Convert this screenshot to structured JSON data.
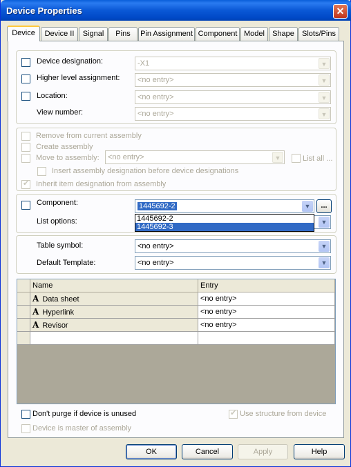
{
  "window": {
    "title": "Device Properties",
    "close": "✕"
  },
  "tabs": [
    {
      "label": "Device",
      "active": true
    },
    {
      "label": "Device II"
    },
    {
      "label": "Signal"
    },
    {
      "label": "Pins"
    },
    {
      "label": "Pin Assignment"
    },
    {
      "label": "Component"
    },
    {
      "label": "Model"
    },
    {
      "label": "Shape"
    },
    {
      "label": "Slots/Pins"
    }
  ],
  "designation": {
    "device_designation_label": "Device designation:",
    "device_designation_value": "-X1",
    "higher_level_label": "Higher level assignment:",
    "higher_level_value": "<no entry>",
    "location_label": "Location:",
    "location_value": "<no entry>",
    "view_number_label": "View number:",
    "view_number_value": "<no entry>"
  },
  "assembly": {
    "remove_label": "Remove from current assembly",
    "create_label": "Create assembly",
    "move_label": "Move to assembly:",
    "move_value": "<no entry>",
    "list_all_label": "List all ...",
    "insert_label": "Insert assembly designation before device designations",
    "inherit_label": "Inherit item designation from assembly"
  },
  "component": {
    "label": "Component:",
    "value": "1445692-2",
    "browse": "...",
    "list_options_label": "List options:",
    "dropdown_options": [
      "1445692-2",
      "1445692-3"
    ],
    "highlighted_option": "1445692-3"
  },
  "symbols": {
    "table_symbol_label": "Table symbol:",
    "table_symbol_value": "<no entry>",
    "default_template_label": "Default Template:",
    "default_template_value": "<no entry>"
  },
  "attributes_table": {
    "columns": [
      "Name",
      "Entry"
    ],
    "rows": [
      {
        "name": "Data sheet",
        "entry": "<no entry>"
      },
      {
        "name": "Hyperlink",
        "entry": "<no entry>"
      },
      {
        "name": "Revisor",
        "entry": "<no entry>"
      }
    ]
  },
  "bottom_options": {
    "dont_purge_label": "Don't purge if device is unused",
    "use_structure_label": "Use structure from device",
    "master_label": "Device is master of assembly"
  },
  "buttons": {
    "ok": "OK",
    "cancel": "Cancel",
    "apply": "Apply",
    "help": "Help"
  },
  "icons": {
    "attribute": "A",
    "combo_arrow": "▼"
  }
}
